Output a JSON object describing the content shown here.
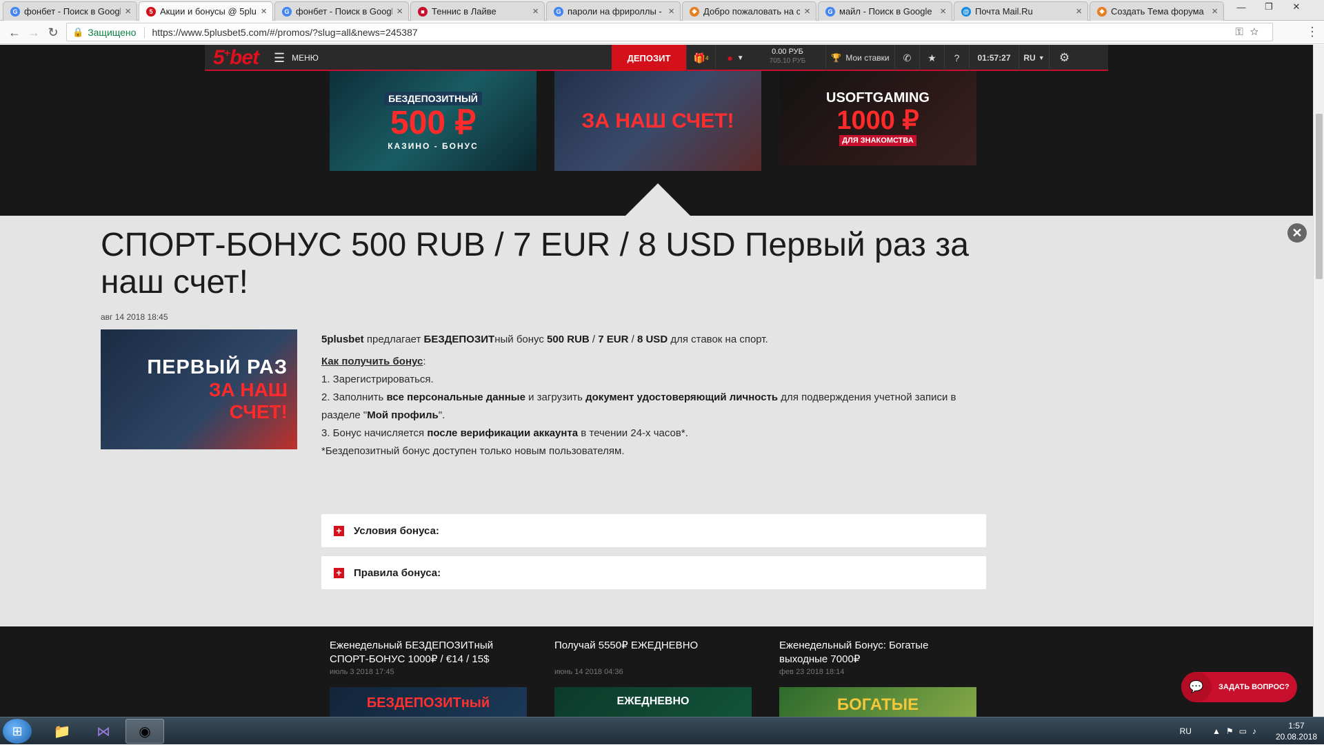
{
  "browser": {
    "tabs": [
      {
        "title": "фонбет - Поиск в Googl",
        "icon": "google-icon",
        "color": "#4285f4",
        "letter": "G"
      },
      {
        "title": "Акции и бонусы @ 5plu",
        "icon": "5bet-icon",
        "color": "#d4111b",
        "letter": "5"
      },
      {
        "title": "фонбет - Поиск в Googl",
        "icon": "google-icon",
        "color": "#4285f4",
        "letter": "G"
      },
      {
        "title": "Теннис в Лайве",
        "icon": "tennis-icon",
        "color": "#c8102e",
        "letter": "■"
      },
      {
        "title": "пароли на фрироллы - ",
        "icon": "google-icon",
        "color": "#4285f4",
        "letter": "G"
      },
      {
        "title": "Добро пожаловать на с",
        "icon": "forum-icon",
        "color": "#e67e22",
        "letter": "◆"
      },
      {
        "title": "майл - Поиск в Google",
        "icon": "google-icon",
        "color": "#4285f4",
        "letter": "G"
      },
      {
        "title": "Почта Mail.Ru",
        "icon": "mailru-icon",
        "color": "#168de2",
        "letter": "@"
      },
      {
        "title": "Создать Тема форума",
        "icon": "forum-icon",
        "color": "#e67e22",
        "letter": "◆"
      }
    ],
    "active_tab": 1,
    "secure_label": "Защищено",
    "url": "https://www.5plusbet5.com/#/promos/?slug=all&news=245387"
  },
  "site_header": {
    "logo": "5",
    "logo_sup": "+",
    "logo_word": "bet",
    "menu_label": "МЕНЮ",
    "deposit_label": "ДЕПОЗИТ",
    "gift_count": "4",
    "balance_main": "0.00 РУБ",
    "balance_bonus": "705.10 РУБ",
    "my_bets_label": "Мои ставки",
    "time": "01:57:27",
    "lang": "RU"
  },
  "strip": {
    "items": [
      {
        "line1": "БЕЗДЕПОЗИТНЫЙ",
        "line2": "500 ₽",
        "line3": "КАЗИНО - БОНУС"
      },
      {
        "line1": "",
        "line2": "ЗА НАШ СЧЕТ!",
        "line3": ""
      },
      {
        "line1": "USOFTGAMING",
        "line2": "1000 ₽",
        "line3": "ДЛЯ ЗНАКОМСТВА"
      }
    ]
  },
  "promo": {
    "title": "СПОРТ-БОНУС 500 RUB / 7 EUR / 8 USD Первый раз за наш счет!",
    "date": "авг 14 2018 18:45",
    "image_line1": "ПЕРВЫЙ РАЗ",
    "image_line2": "ЗА НАШ",
    "image_line3": "СЧЕТ!",
    "intro_brand": "5plusbet",
    "intro_1": " предлагает ",
    "intro_b1": "БЕЗДЕПОЗИТ",
    "intro_2": "ный бонус ",
    "intro_b2": "500 RUB",
    "intro_3": "  / ",
    "intro_b3": "7 EUR",
    "intro_4": " / ",
    "intro_b4": "8 USD",
    "intro_5": " для ставок на спорт.",
    "how_label": "Как получить бонус",
    "how_colon": ":",
    "step1": "1. Зарегистрироваться.",
    "step2_a": "2. Заполнить ",
    "step2_b1": "все персональные данные",
    "step2_c": " и загрузить ",
    "step2_b2": "документ удостоверяющий личность",
    "step2_d": " для подверждения учетной записи в разделе \"",
    "step2_b3": "Мой профиль",
    "step2_e": "\".",
    "step3_a": "3. Бонус начисляется ",
    "step3_b": "после верификации аккаунта",
    "step3_c": " в течении 24-х часов*.",
    "note": "*Бездепозитный бонус доступен только новым пользователям.",
    "accordion_conditions": "Условия бонуса:",
    "accordion_rules": "Правила бонуса:"
  },
  "more_promos": [
    {
      "title": "Еженедельный БЕЗДЕПОЗИТный СПОРТ-БОНУС 1000₽ / €14 / 15$",
      "date": "июль 3 2018 17:45",
      "img": "БЕЗДЕПОЗИТный"
    },
    {
      "title": "Получай 5550₽ ЕЖЕДНЕВНО",
      "date": "июнь 14 2018 04:36",
      "img": "ЕЖЕДНЕВНО"
    },
    {
      "title": "Еженедельный Бонус: Богатые выходные 7000₽",
      "date": "фев 23 2018 18:14",
      "img": "БОГАТЫЕ"
    }
  ],
  "chat_label": "ЗАДАТЬ ВОПРОС?",
  "taskbar": {
    "lang": "RU",
    "time": "1:57",
    "date": "20.08.2018"
  }
}
